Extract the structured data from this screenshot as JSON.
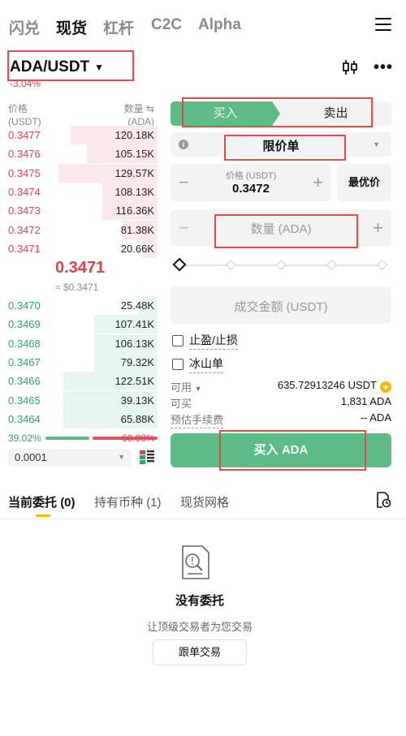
{
  "top_tabs": [
    "闪兑",
    "现货",
    "杠杆",
    "C2C",
    "Alpha"
  ],
  "active_tab": "现货",
  "pair": {
    "name": "ADA/USDT",
    "change": "-3.04%"
  },
  "orderbook": {
    "price_header": "价格",
    "price_unit": "(USDT)",
    "qty_header": "数量",
    "qty_unit": "(ADA)",
    "asks": [
      {
        "price": "0.3477",
        "qty": "120.18K",
        "depth": 0.55
      },
      {
        "price": "0.3476",
        "qty": "105.15K",
        "depth": 0.45
      },
      {
        "price": "0.3475",
        "qty": "129.57K",
        "depth": 0.63
      },
      {
        "price": "0.3474",
        "qty": "108.13K",
        "depth": 0.35
      },
      {
        "price": "0.3473",
        "qty": "116.36K",
        "depth": 0.35
      },
      {
        "price": "0.3472",
        "qty": "81.38K",
        "depth": 0.22
      },
      {
        "price": "0.3471",
        "qty": "20.66K",
        "depth": 0.1
      }
    ],
    "last_price": "0.3471",
    "last_price_usd": "≈ $0.3471",
    "bids": [
      {
        "price": "0.3470",
        "qty": "25.48K",
        "depth": 0.12
      },
      {
        "price": "0.3469",
        "qty": "107.41K",
        "depth": 0.4
      },
      {
        "price": "0.3468",
        "qty": "106.13K",
        "depth": 0.4
      },
      {
        "price": "0.3467",
        "qty": "79.32K",
        "depth": 0.4
      },
      {
        "price": "0.3466",
        "qty": "122.51K",
        "depth": 0.6
      },
      {
        "price": "0.3465",
        "qty": "39.13K",
        "depth": 0.6
      },
      {
        "price": "0.3464",
        "qty": "65.88K",
        "depth": 0.6
      }
    ],
    "buy_ratio": "39.02%",
    "sell_ratio": "60.98%",
    "buy_ratio_value": 0.3902,
    "precision": "0.0001"
  },
  "order_form": {
    "buy_label": "买入",
    "sell_label": "卖出",
    "order_type": "限价单",
    "info_glyph": "i",
    "price_label": "价格 (USDT)",
    "price_value": "0.3472",
    "best_price_label": "最优价",
    "quantity_placeholder": "数量 (ADA)",
    "total_placeholder": "成交金额 (USDT)",
    "tpsl_label": "止盈/止损",
    "iceberg_label": "冰山单",
    "available_label": "可用",
    "available_value": "635.72913246 USDT",
    "buyable_label": "可买",
    "buyable_value": "1,831 ADA",
    "fee_label": "预估手续费",
    "fee_value": "-- ADA",
    "submit_label": "买入 ADA",
    "minus_glyph": "−",
    "plus_glyph": "+",
    "coin_plus_glyph": "+"
  },
  "bottom_tabs": {
    "open_orders": "当前委托",
    "open_orders_count": "(0)",
    "holdings": "持有币种",
    "holdings_count": "(1)",
    "grid": "现货网格"
  },
  "empty_state": {
    "title": "没有委托",
    "subtitle": "让顶级交易者为您交易",
    "button": "跟单交易"
  },
  "colors": {
    "buy_green": "#5dbb85",
    "sell_red": "#d9454e",
    "highlight_box": "#e24b4b",
    "accent_yellow": "#f0b90b"
  }
}
